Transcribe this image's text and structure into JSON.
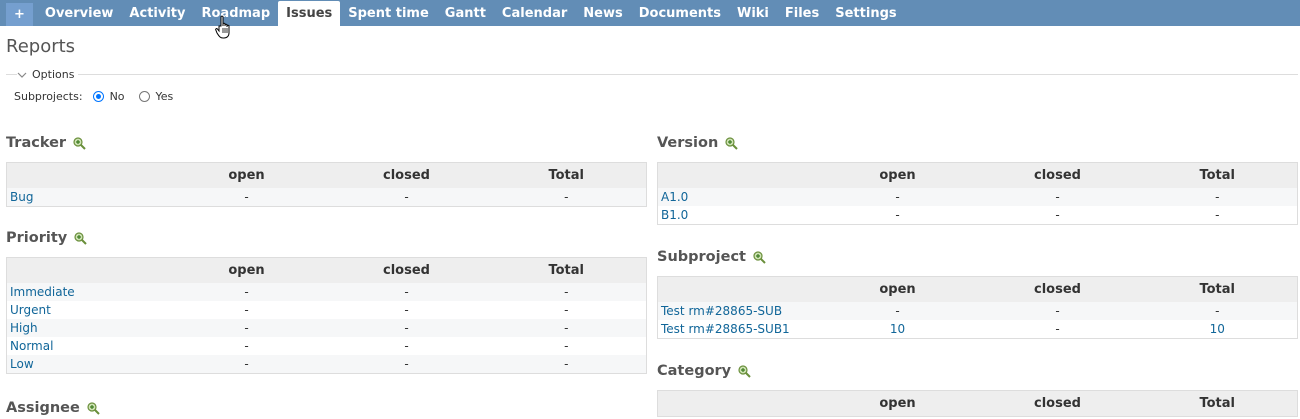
{
  "menu": {
    "new_label": "+",
    "tabs": [
      "Overview",
      "Activity",
      "Roadmap",
      "Issues",
      "Spent time",
      "Gantt",
      "Calendar",
      "News",
      "Documents",
      "Wiki",
      "Files",
      "Settings"
    ],
    "active": "Issues"
  },
  "page": {
    "title": "Reports",
    "options_label": "Options",
    "subprojects_label": "Subprojects:",
    "radio_no": "No",
    "radio_yes": "Yes"
  },
  "columns": {
    "open": "open",
    "closed": "closed",
    "total": "Total"
  },
  "sections": {
    "tracker": {
      "title": "Tracker",
      "rows": [
        {
          "name": "Bug",
          "open": "-",
          "closed": "-",
          "total": "-"
        }
      ]
    },
    "priority": {
      "title": "Priority",
      "rows": [
        {
          "name": "Immediate",
          "open": "-",
          "closed": "-",
          "total": "-"
        },
        {
          "name": "Urgent",
          "open": "-",
          "closed": "-",
          "total": "-"
        },
        {
          "name": "High",
          "open": "-",
          "closed": "-",
          "total": "-"
        },
        {
          "name": "Normal",
          "open": "-",
          "closed": "-",
          "total": "-"
        },
        {
          "name": "Low",
          "open": "-",
          "closed": "-",
          "total": "-"
        }
      ]
    },
    "assignee": {
      "title": "Assignee"
    },
    "version": {
      "title": "Version",
      "rows": [
        {
          "name": "A1.0",
          "open": "-",
          "closed": "-",
          "total": "-"
        },
        {
          "name": "B1.0",
          "open": "-",
          "closed": "-",
          "total": "-"
        }
      ]
    },
    "subproject": {
      "title": "Subproject",
      "rows": [
        {
          "name": "Test rm#28865-SUB",
          "open": "-",
          "closed": "-",
          "total": "-"
        },
        {
          "name": "Test rm#28865-SUB1",
          "open": "10",
          "closed": "-",
          "total": "10"
        }
      ]
    },
    "category": {
      "title": "Category"
    }
  }
}
